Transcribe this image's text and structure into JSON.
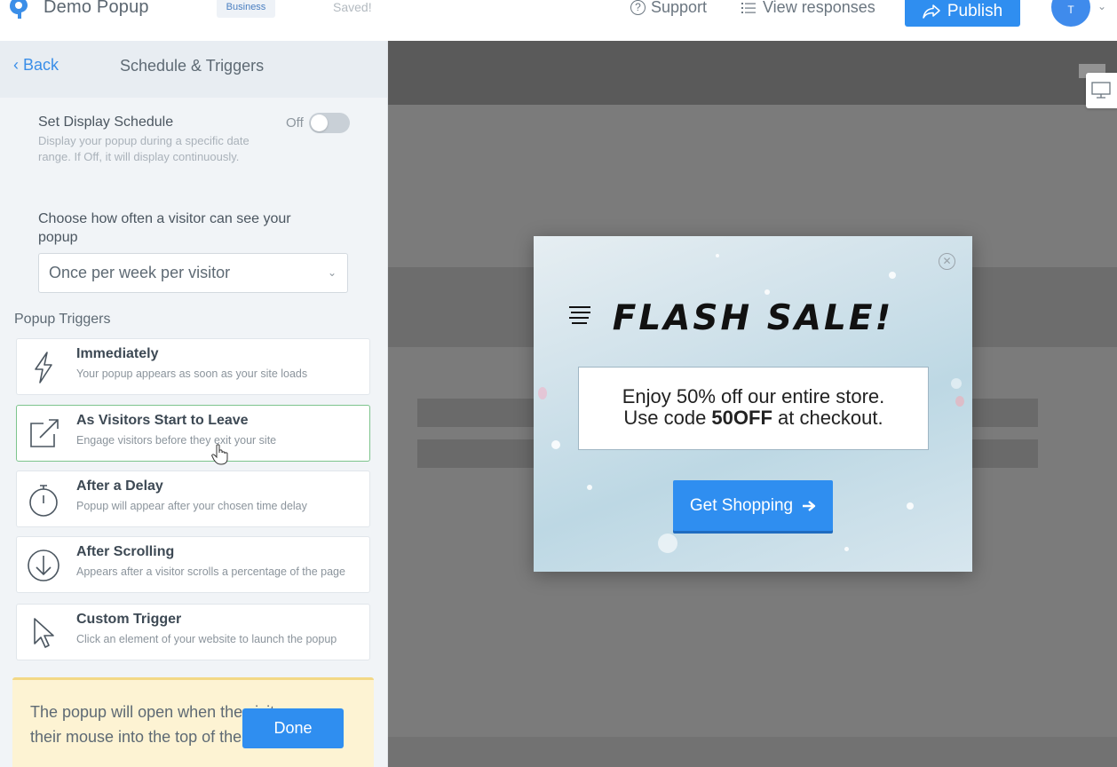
{
  "topbar": {
    "app_title": "Demo Popup",
    "plan_badge": "Business",
    "save_status": "Saved!",
    "support_label": "Support",
    "view_responses_label": "View responses",
    "publish_label": "Publish",
    "avatar_initial": "T"
  },
  "sidebar": {
    "back_label": "Back",
    "section_title": "Schedule & Triggers",
    "schedule": {
      "label": "Set Display Schedule",
      "description": "Display your popup during a specific date range. If Off, it will display continuously.",
      "toggle_state": "Off"
    },
    "frequency": {
      "label": "Choose how often a visitor can see your popup",
      "selected": "Once per week per visitor"
    },
    "triggers_label": "Popup Triggers",
    "triggers": [
      {
        "title": "Immediately",
        "description": "Your popup appears as soon as your site loads",
        "icon": "lightning-icon"
      },
      {
        "title": "As Visitors Start to Leave",
        "description": "Engage visitors before they exit your site",
        "icon": "exit-arrow-icon"
      },
      {
        "title": "After a Delay",
        "description": "Popup will appear after your chosen time delay",
        "icon": "stopwatch-icon"
      },
      {
        "title": "After Scrolling",
        "description": "Appears after a visitor scrolls a percentage of the page",
        "icon": "scroll-down-icon"
      },
      {
        "title": "Custom Trigger",
        "description": "Click an element of your website to launch the popup",
        "icon": "pointer-icon"
      }
    ],
    "info_text": "The popup will open when the visitor moves their mouse into the top of their browser.",
    "done_label": "Done"
  },
  "popup": {
    "headline": "FLASH SALE!",
    "line1": "Enjoy 50% off our entire store.",
    "line2_prefix": "Use code ",
    "line2_code": "50OFF",
    "line2_suffix": " at checkout.",
    "cta_label": "Get Shopping"
  },
  "colors": {
    "accent": "#2f8ef0",
    "selected_border": "#7dc48d",
    "info_bg": "#fdf3d3"
  }
}
